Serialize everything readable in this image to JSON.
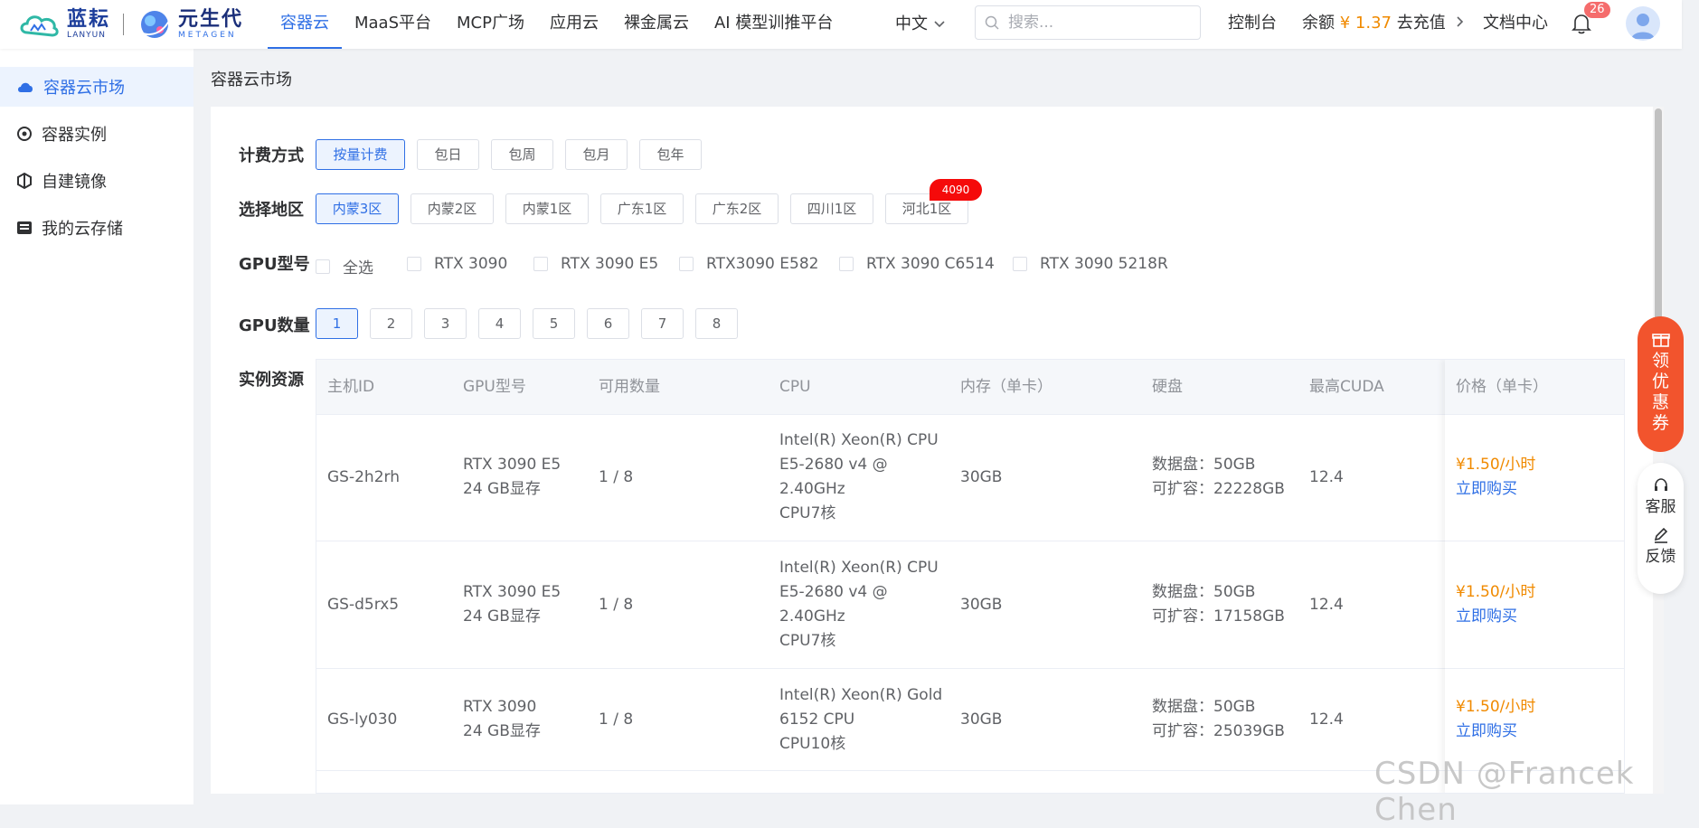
{
  "brand": {
    "logo1_cn": "蓝耘",
    "logo1_en": "LANYUN",
    "logo2_cn": "元生代",
    "logo2_en": "METAGEN"
  },
  "nav": {
    "items": [
      "容器云",
      "MaaS平台",
      "MCP广场",
      "应用云",
      "裸金属云",
      "AI 模型训推平台"
    ],
    "active_index": 0
  },
  "header": {
    "lang": "中文",
    "search_placeholder": "搜索...",
    "console": "控制台",
    "balance_label": "余额",
    "balance_amount": "¥ 1.37",
    "recharge": "去充值",
    "docs": "文档中心",
    "notif_count": "26"
  },
  "sidebar": {
    "items": [
      "容器云市场",
      "容器实例",
      "自建镜像",
      "我的云存储"
    ],
    "active_index": 0
  },
  "page": {
    "title": "容器云市场"
  },
  "filters": {
    "billing": {
      "label": "计费方式",
      "options": [
        "按量计费",
        "包日",
        "包周",
        "包月",
        "包年"
      ],
      "selected": "按量计费"
    },
    "region": {
      "label": "选择地区",
      "options": [
        "内蒙3区",
        "内蒙2区",
        "内蒙1区",
        "广东1区",
        "广东2区",
        "四川1区",
        "河北1区"
      ],
      "selected": "内蒙3区",
      "hot_tag": "4090"
    },
    "gpu_model": {
      "label": "GPU型号",
      "options": [
        "全选",
        "RTX 3090",
        "RTX 3090 E5",
        "RTX3090 E582",
        "RTX 3090 C6514",
        "RTX 3090 5218R"
      ]
    },
    "gpu_count": {
      "label": "GPU数量",
      "options": [
        "1",
        "2",
        "3",
        "4",
        "5",
        "6",
        "7",
        "8"
      ],
      "selected": "1"
    }
  },
  "table": {
    "label": "实例资源",
    "headers": [
      "主机ID",
      "GPU型号",
      "可用数量",
      "CPU",
      "内存（单卡）",
      "硬盘",
      "最高CUDA",
      "价格（单卡）"
    ],
    "rows": [
      {
        "id": "GS-2h2rh",
        "gpu1": "RTX 3090 E5",
        "gpu2": "24 GB显存",
        "avail": "1 / 8",
        "cpu": [
          "Intel(R) Xeon(R) CPU",
          "E5-2680 v4 @",
          "2.40GHz",
          "CPU7核"
        ],
        "mem": "30GB",
        "disk1": "数据盘：50GB",
        "disk2": "可扩容：22228GB",
        "cuda": "12.4",
        "price": "¥1.50/小时",
        "buy": "立即购买"
      },
      {
        "id": "GS-d5rx5",
        "gpu1": "RTX 3090 E5",
        "gpu2": "24 GB显存",
        "avail": "1 / 8",
        "cpu": [
          "Intel(R) Xeon(R) CPU",
          "E5-2680 v4 @",
          "2.40GHz",
          "CPU7核"
        ],
        "mem": "30GB",
        "disk1": "数据盘：50GB",
        "disk2": "可扩容：17158GB",
        "cuda": "12.4",
        "price": "¥1.50/小时",
        "buy": "立即购买"
      },
      {
        "id": "GS-ly030",
        "gpu1": "RTX 3090",
        "gpu2": "24 GB显存",
        "avail": "1 / 8",
        "cpu": [
          "Intel(R) Xeon(R) Gold",
          "6152 CPU",
          "CPU10核"
        ],
        "mem": "30GB",
        "disk1": "数据盘：50GB",
        "disk2": "可扩容：25039GB",
        "cuda": "12.4",
        "price": "¥1.50/小时",
        "buy": "立即购买"
      }
    ]
  },
  "floating": {
    "coupon": [
      "领",
      "优",
      "惠",
      "券"
    ],
    "service": "客服",
    "feedback": "反馈"
  },
  "watermark": "CSDN @Francek Chen",
  "colors": {
    "primary": "#2f6fe5",
    "price": "#f08a00",
    "coupon": "#f2542d",
    "hot": "#f50a0a"
  }
}
